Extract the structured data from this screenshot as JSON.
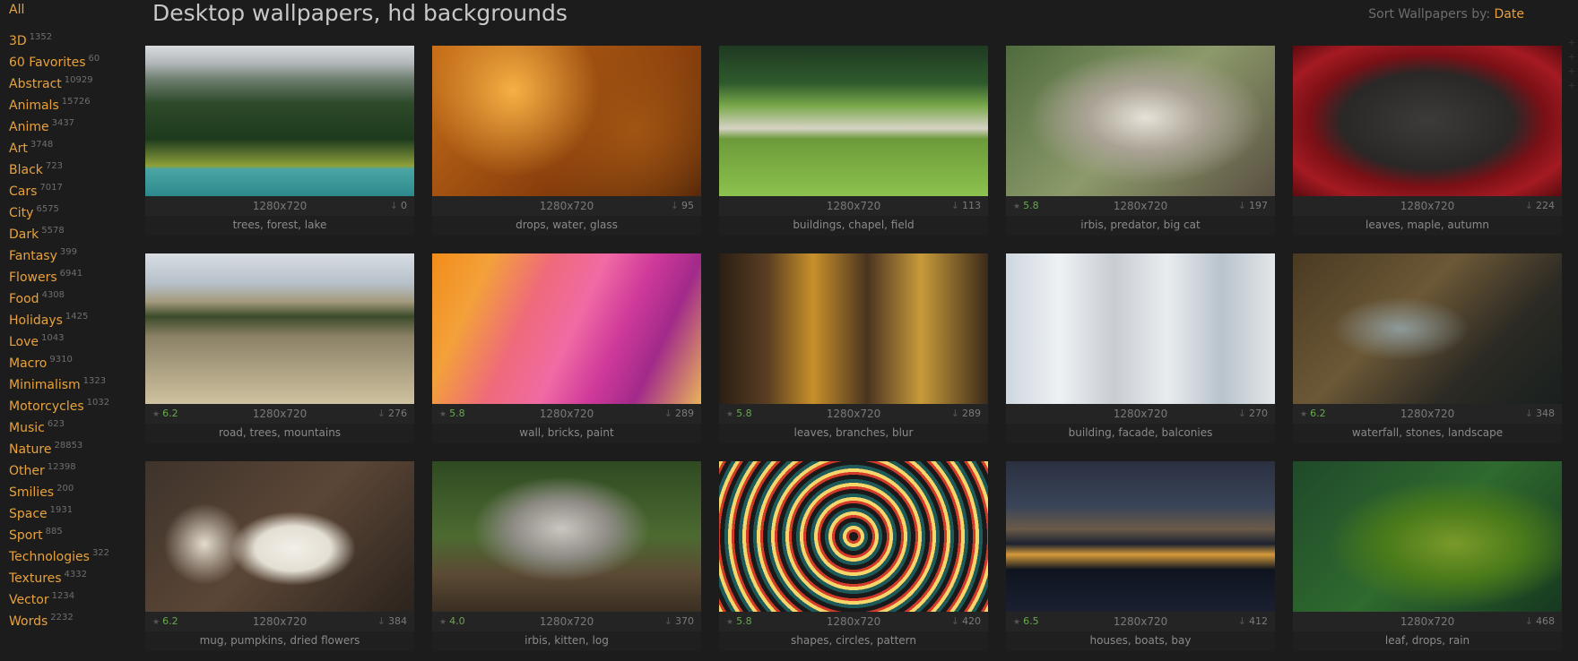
{
  "sidebar": {
    "all": "All",
    "categories": [
      {
        "label": "3D",
        "count": "1352"
      },
      {
        "label": "60 Favorites",
        "count": "60"
      },
      {
        "label": "Abstract",
        "count": "10929"
      },
      {
        "label": "Animals",
        "count": "15726"
      },
      {
        "label": "Anime",
        "count": "3437"
      },
      {
        "label": "Art",
        "count": "3748"
      },
      {
        "label": "Black",
        "count": "723"
      },
      {
        "label": "Cars",
        "count": "7017"
      },
      {
        "label": "City",
        "count": "6575"
      },
      {
        "label": "Dark",
        "count": "5578"
      },
      {
        "label": "Fantasy",
        "count": "399"
      },
      {
        "label": "Flowers",
        "count": "6941"
      },
      {
        "label": "Food",
        "count": "4308"
      },
      {
        "label": "Holidays",
        "count": "1425"
      },
      {
        "label": "Love",
        "count": "1043"
      },
      {
        "label": "Macro",
        "count": "9310"
      },
      {
        "label": "Minimalism",
        "count": "1323"
      },
      {
        "label": "Motorcycles",
        "count": "1032"
      },
      {
        "label": "Music",
        "count": "623"
      },
      {
        "label": "Nature",
        "count": "28853"
      },
      {
        "label": "Other",
        "count": "12398"
      },
      {
        "label": "Smilies",
        "count": "200"
      },
      {
        "label": "Space",
        "count": "1931"
      },
      {
        "label": "Sport",
        "count": "885"
      },
      {
        "label": "Technologies",
        "count": "322"
      },
      {
        "label": "Textures",
        "count": "4332"
      },
      {
        "label": "Vector",
        "count": "1234"
      },
      {
        "label": "Words",
        "count": "2232"
      }
    ]
  },
  "header": {
    "title": "Desktop wallpapers, hd backgrounds",
    "sort_label": "Sort Wallpapers by:",
    "sort_value": "Date"
  },
  "icons": {
    "star": "star-icon",
    "download": "download-arrow-icon"
  },
  "colors": {
    "accent": "#e9a23b",
    "rating": "#6aa84f",
    "background": "#1c1c1c"
  },
  "wallpapers": [
    {
      "resolution": "1280x720",
      "rating": "",
      "downloads": "0",
      "tags": "trees, forest, lake"
    },
    {
      "resolution": "1280x720",
      "rating": "",
      "downloads": "95",
      "tags": "drops, water, glass"
    },
    {
      "resolution": "1280x720",
      "rating": "",
      "downloads": "113",
      "tags": "buildings, chapel, field"
    },
    {
      "resolution": "1280x720",
      "rating": "5.8",
      "downloads": "197",
      "tags": "irbis, predator, big cat"
    },
    {
      "resolution": "1280x720",
      "rating": "",
      "downloads": "224",
      "tags": "leaves, maple, autumn"
    },
    {
      "resolution": "1280x720",
      "rating": "6.2",
      "downloads": "276",
      "tags": "road, trees, mountains"
    },
    {
      "resolution": "1280x720",
      "rating": "5.8",
      "downloads": "289",
      "tags": "wall, bricks, paint"
    },
    {
      "resolution": "1280x720",
      "rating": "5.8",
      "downloads": "289",
      "tags": "leaves, branches, blur"
    },
    {
      "resolution": "1280x720",
      "rating": "",
      "downloads": "270",
      "tags": "building, facade, balconies"
    },
    {
      "resolution": "1280x720",
      "rating": "6.2",
      "downloads": "348",
      "tags": "waterfall, stones, landscape"
    },
    {
      "resolution": "1280x720",
      "rating": "6.2",
      "downloads": "384",
      "tags": "mug, pumpkins, dried flowers"
    },
    {
      "resolution": "1280x720",
      "rating": "4.0",
      "downloads": "370",
      "tags": "irbis, kitten, log"
    },
    {
      "resolution": "1280x720",
      "rating": "5.8",
      "downloads": "420",
      "tags": "shapes, circles, pattern"
    },
    {
      "resolution": "1280x720",
      "rating": "6.5",
      "downloads": "412",
      "tags": "houses, boats, bay"
    },
    {
      "resolution": "1280x720",
      "rating": "",
      "downloads": "468",
      "tags": "leaf, drops, rain"
    }
  ]
}
